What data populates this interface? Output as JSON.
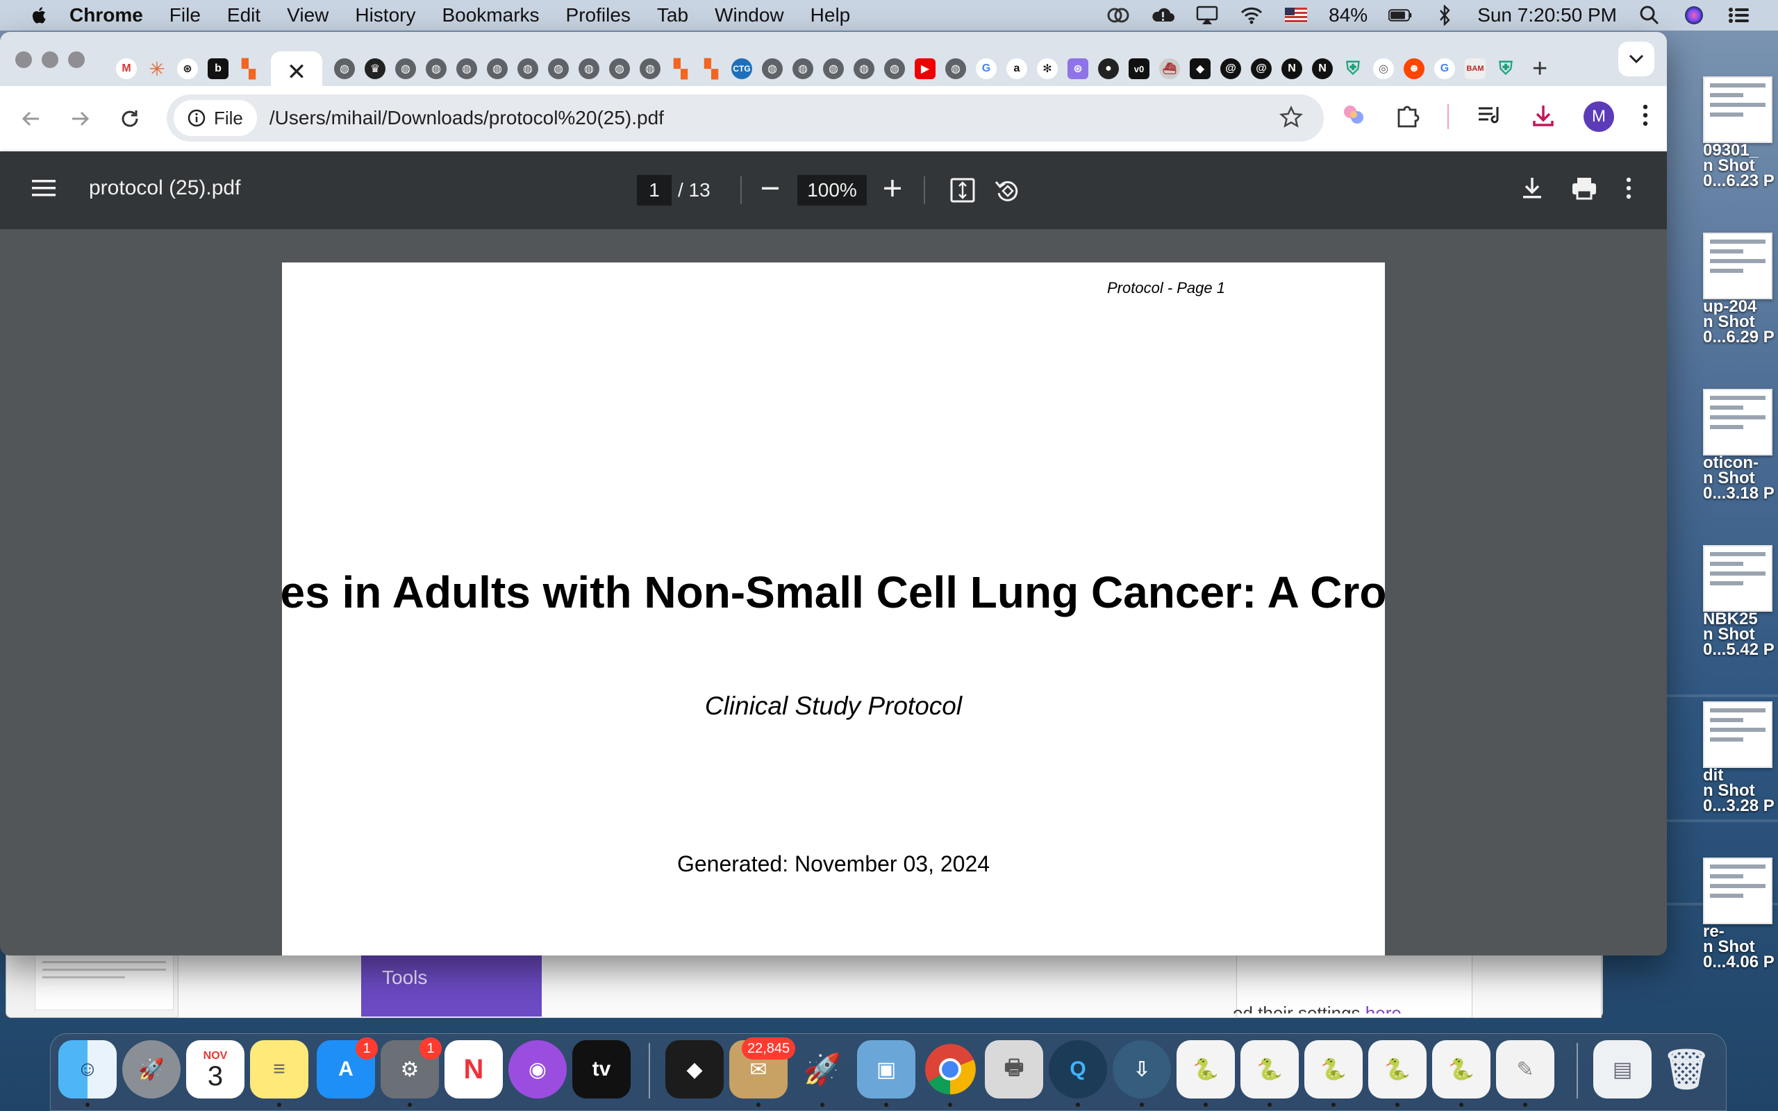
{
  "menubar": {
    "app_name": "Chrome",
    "menus": [
      "File",
      "Edit",
      "View",
      "History",
      "Bookmarks",
      "Profiles",
      "Tab",
      "Window",
      "Help"
    ],
    "battery": "84%",
    "clock": "Sun 7:20:50 PM"
  },
  "browser": {
    "active_tab_close": "✕",
    "new_tab": "+",
    "site_chip": "File",
    "url": "/Users/mihail/Downloads/protocol%20(25).pdf",
    "avatar_letter": "M"
  },
  "pdf": {
    "file_name": "protocol (25).pdf",
    "current_page": "1",
    "total_pages": "/ 13",
    "zoom": "100%",
    "page_header": "Protocol - Page 1",
    "title_visible": "es in Adults with Non-Small Cell Lung Cancer: A Cro",
    "subtitle": "Clinical Study Protocol",
    "generated": "Generated: November 03, 2024"
  },
  "background_windows": {
    "tools_label": "Tools",
    "partial_text": "ed their settings",
    "partial_link": "here"
  },
  "desktop_files": [
    {
      "line1": "09301_",
      "line2": "n Shot",
      "line3": "0...6.23 P"
    },
    {
      "line1": "up-204",
      "line2": "n Shot",
      "line3": "0...6.29 P"
    },
    {
      "line1": "oticon-",
      "line2": "n Shot",
      "line3": "0...3.18 P"
    },
    {
      "line1": "NBK25",
      "line2": "n Shot",
      "line3": "0...5.42 P"
    },
    {
      "line1": "dit",
      "line2": "n Shot",
      "line3": "0...3.28 P"
    },
    {
      "line1": "re-",
      "line2": "n Shot",
      "line3": "0...4.06 P"
    }
  ],
  "dock": {
    "calendar_month": "NOV",
    "calendar_day": "3",
    "appstore_badge": "1",
    "settings_badge": "1",
    "mail_badge": "22,845",
    "tv_label": "tv"
  },
  "colors": {
    "menubar_bg": "#c9d4e2",
    "pdf_toolbar_bg": "#323639",
    "pdf_area_bg": "#525659",
    "avatar_bg": "#5b3bb8",
    "tools_panel": "#6c4bc4",
    "download_icon": "#c2185b"
  }
}
